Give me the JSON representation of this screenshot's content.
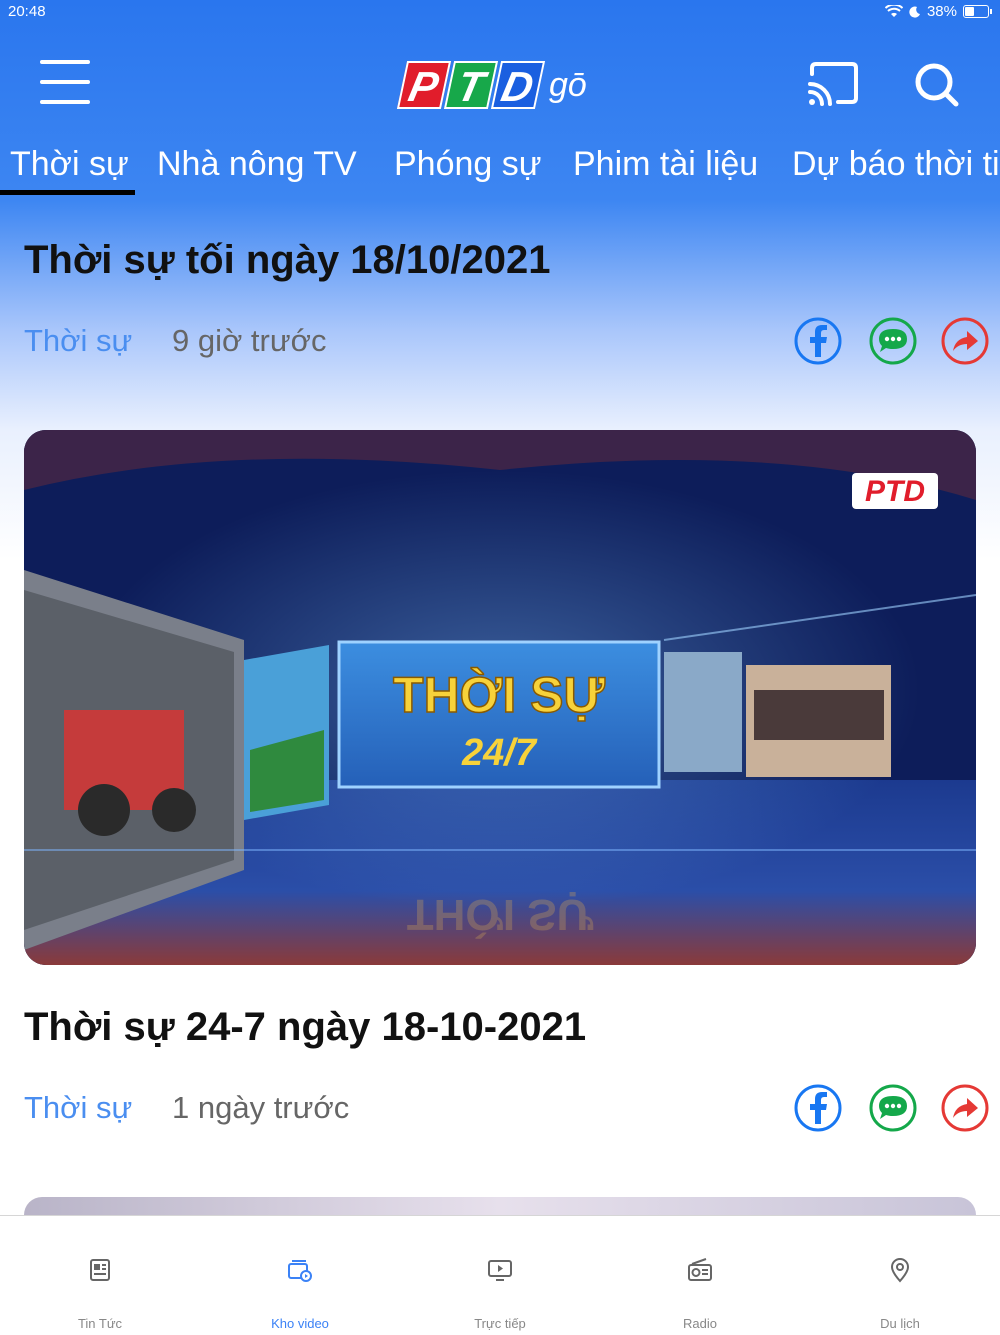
{
  "status_bar": {
    "time": "20:48",
    "battery": "38%"
  },
  "header": {
    "logo_letters": [
      "P",
      "T",
      "D"
    ],
    "logo_suffix": "gō"
  },
  "tabs": [
    "Thời sự",
    "Nhà nông TV",
    "Phóng sự",
    "Phim tài liệu",
    "Dự báo thời ti"
  ],
  "articles": [
    {
      "title": "Thời sự tối ngày 18/10/2021",
      "category": "Thời sự",
      "time": "9 giờ trước"
    },
    {
      "title": "Thời sự 24-7 ngày 18-10-2021",
      "category": "Thời sự",
      "time": "1 ngày trước"
    }
  ],
  "thumbnail": {
    "headline": "THỜI SỰ",
    "subline": "24/7",
    "logo": "PTD"
  },
  "tabbar": [
    {
      "label": "Tin Tức",
      "icon": "newspaper-icon"
    },
    {
      "label": "Kho video",
      "icon": "video-library-icon",
      "active": true
    },
    {
      "label": "Trực tiếp",
      "icon": "live-tv-icon"
    },
    {
      "label": "Radio",
      "icon": "radio-icon"
    },
    {
      "label": "Du lịch",
      "icon": "location-pin-icon"
    }
  ],
  "colors": {
    "accent": "#3b82f6",
    "header_blue": "#2a76ee",
    "facebook": "#1877f2",
    "message": "#14a84a",
    "share": "#e53935",
    "logo_red": "#e11d2b",
    "logo_green": "#17a84a",
    "logo_blue": "#1a5fe0"
  }
}
